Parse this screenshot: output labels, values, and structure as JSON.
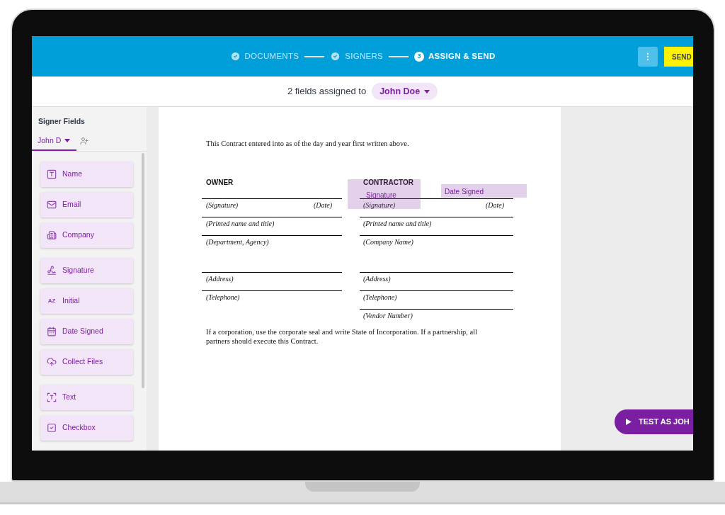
{
  "stepper": {
    "steps": [
      {
        "label": "DOCUMENTS",
        "done": true
      },
      {
        "label": "SIGNERS",
        "done": true
      },
      {
        "label": "ASSIGN & SEND",
        "done": false,
        "number": "3"
      }
    ],
    "send_button": "SEND"
  },
  "assignment": {
    "text": "2 fields assigned to",
    "signer": "John Doe"
  },
  "sidebar": {
    "title": "Signer Fields",
    "signer_tab": {
      "label": "John D",
      "selected": true
    },
    "groups": [
      [
        {
          "kind": "name",
          "label": "Name"
        },
        {
          "kind": "email",
          "label": "Email"
        },
        {
          "kind": "company",
          "label": "Company"
        }
      ],
      [
        {
          "kind": "signature",
          "label": "Signature"
        },
        {
          "kind": "initial",
          "label": "Initial",
          "icon_text": "AZ"
        },
        {
          "kind": "date",
          "label": "Date Signed"
        },
        {
          "kind": "files",
          "label": "Collect Files"
        }
      ],
      [
        {
          "kind": "text",
          "label": "Text"
        },
        {
          "kind": "checkbox",
          "label": "Checkbox"
        }
      ]
    ]
  },
  "document": {
    "intro": "This Contract entered into as of the day and year first written above.",
    "owner_heading": "OWNER",
    "contractor_heading": "CONTRACTOR",
    "rows": [
      {
        "left": "(Signature)",
        "left_end": "(Date)",
        "right": "(Signature)",
        "right_end": "(Date)"
      },
      {
        "left": "(Printed name and title)",
        "right": "(Printed name and title)"
      },
      {
        "left": "(Department, Agency)",
        "right": "(Company Name)",
        "tall": true
      },
      {
        "left": "(Address)",
        "right": "(Address)"
      },
      {
        "left": "(Telephone)",
        "right": "(Telephone)"
      },
      {
        "right": "(Vendor Number)"
      }
    ],
    "closing": "If a corporation, use the corporate seal and write State of Incorporation.  If a partnership, all partners should execute this Contract.",
    "placed_fields": [
      {
        "kind": "signature",
        "label": "Signature"
      },
      {
        "kind": "date",
        "label": "Date Signed"
      }
    ]
  },
  "test_button": "TEST AS JOH"
}
